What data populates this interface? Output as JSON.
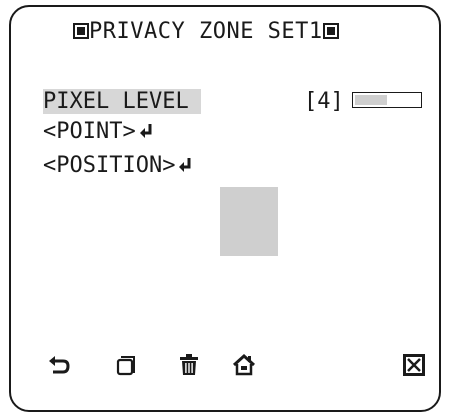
{
  "screen": {
    "title": "PRIVACY ZONE SET1"
  },
  "menu": {
    "items": [
      {
        "label": "PIXEL LEVEL",
        "value": "[4]",
        "selected": true
      },
      {
        "label": "<POINT>",
        "has_enter": true
      },
      {
        "label": "<POSITION>",
        "has_enter": true
      }
    ],
    "pixel_level_fill_fraction": 0.5
  },
  "toolbar": {
    "icons": [
      "back-icon",
      "copy-icon",
      "delete-icon",
      "home-icon",
      "close-icon"
    ]
  },
  "colors": {
    "foreground": "#1a1a1a",
    "highlight": "#d7d7d7",
    "zone": "#cfcfcf"
  }
}
